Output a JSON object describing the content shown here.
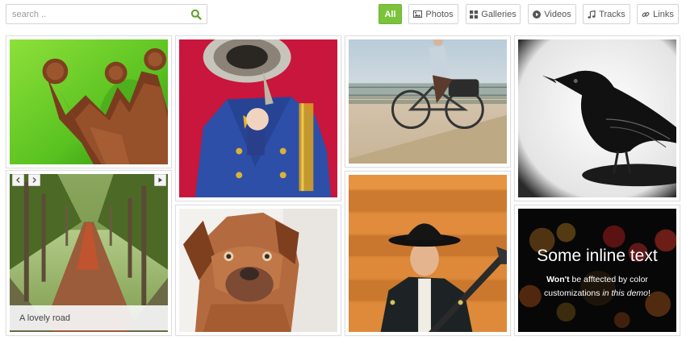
{
  "search": {
    "placeholder": "search ..",
    "value": ""
  },
  "filters": [
    {
      "label": "All",
      "icon": "none",
      "active": true
    },
    {
      "label": "Photos",
      "icon": "image-icon",
      "active": false
    },
    {
      "label": "Galleries",
      "icon": "grid-icon",
      "active": false
    },
    {
      "label": "Videos",
      "icon": "play-icon",
      "active": false
    },
    {
      "label": "Tracks",
      "icon": "music-icon",
      "active": false
    },
    {
      "label": "Links",
      "icon": "link-icon",
      "active": false
    }
  ],
  "gallery": {
    "road_caption": "A lovely road",
    "inline_text": {
      "title": "Some inline text",
      "line1_bold": "Won't",
      "line1_rest": " be afftected by color",
      "line2_start": "customizations ",
      "line2_italic": "in this demo",
      "line2_end": "!"
    }
  },
  "colors": {
    "accent": "#7cc33c",
    "border": "#d4d4d4"
  }
}
